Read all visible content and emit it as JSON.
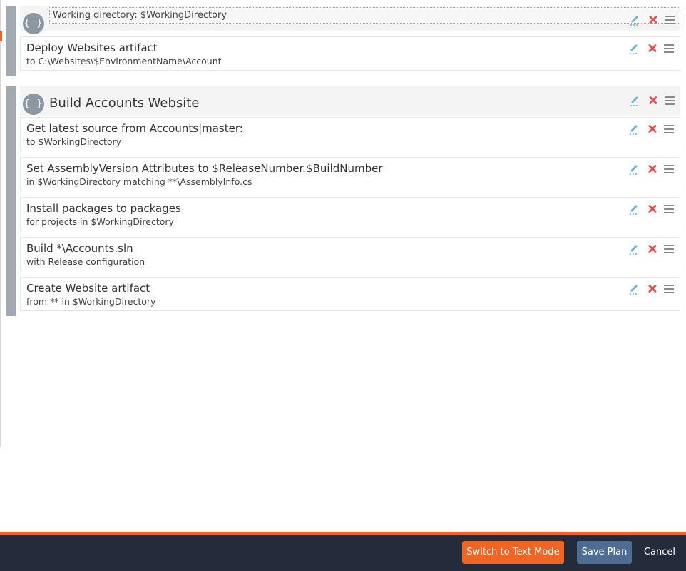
{
  "blocks": [
    {
      "context": "Working directory: $WorkingDirectory",
      "steps": [
        {
          "title": "Deploy Websites artifact",
          "desc": "to C:\\Websites\\$EnvironmentName\\Account"
        }
      ]
    },
    {
      "title": "Build Accounts Website",
      "steps": [
        {
          "title": "Get latest source from Accounts|master:",
          "desc": "to $WorkingDirectory"
        },
        {
          "title": "Set AssemblyVersion Attributes to $ReleaseNumber.$BuildNumber",
          "desc": "in $WorkingDirectory matching **\\AssemblyInfo.cs"
        },
        {
          "title": "Install packages to packages",
          "desc": "for projects in $WorkingDirectory"
        },
        {
          "title": "Build *\\Accounts.sln",
          "desc": "with Release configuration"
        },
        {
          "title": "Create Website artifact",
          "desc": "from ** in $WorkingDirectory"
        }
      ]
    }
  ],
  "icons": {
    "block": "braces-icon",
    "edit": "pencil-icon",
    "delete": "close-icon",
    "drag": "drag-handle-icon"
  },
  "footer": {
    "switch_label": "Switch to Text Mode",
    "save_label": "Save Plan",
    "cancel_label": "Cancel"
  },
  "colors": {
    "accent": "#f06424",
    "primary": "#4f6d93",
    "footer_bg": "#242b3a",
    "block_bar": "#a3a9b3",
    "delete": "#d85a5a",
    "edit": "#6fb3d2"
  }
}
